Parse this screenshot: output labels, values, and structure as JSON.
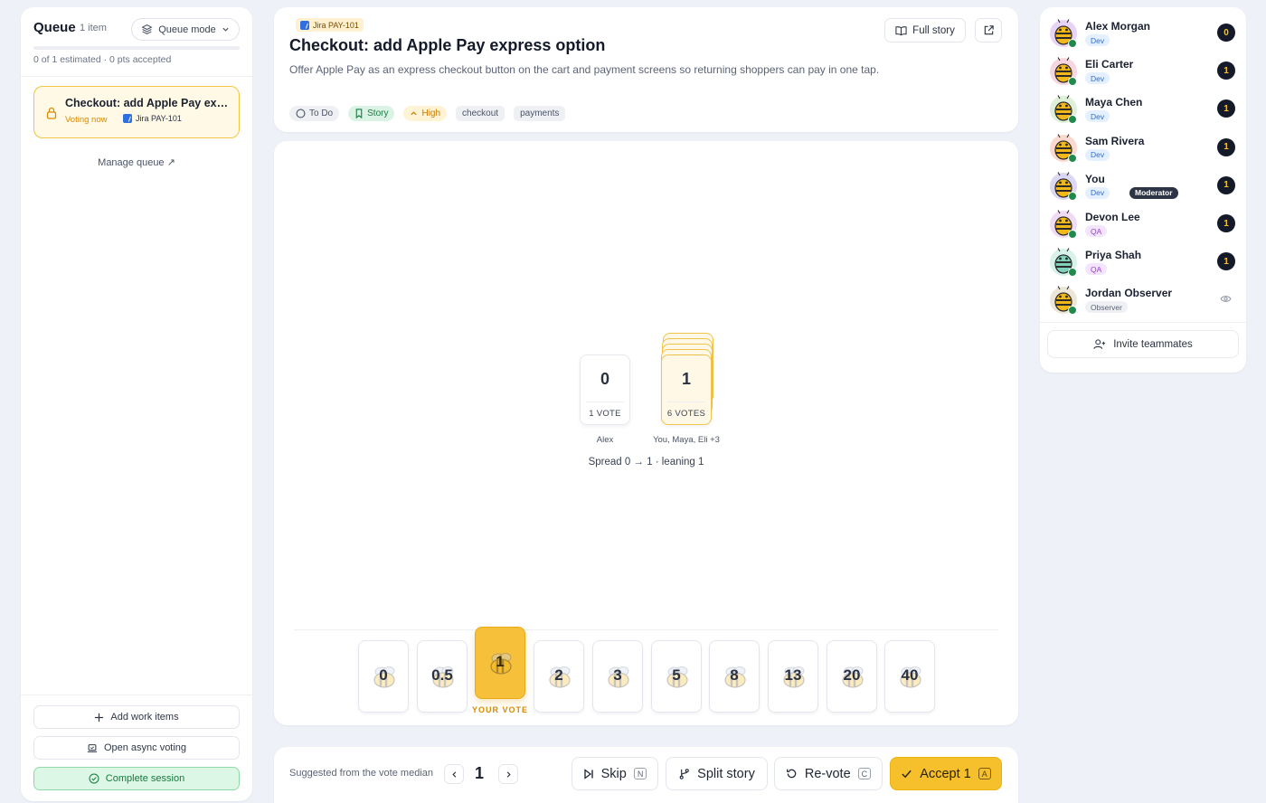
{
  "queue": {
    "title": "Queue",
    "count": "1 item",
    "mode_label": "Queue mode",
    "progress_fraction": 0,
    "stats": "0 of 1 estimated · 0 pts accepted",
    "item": {
      "title": "Checkout: add Apple Pay express option",
      "status": "Voting now",
      "jira": "Jira PAY-101"
    },
    "manage_label": "Manage queue ↗",
    "add_label": "Add work items",
    "async_label": "Open async voting",
    "complete_label": "Complete session"
  },
  "story": {
    "jira": "Jira PAY-101",
    "title": "Checkout: add Apple Pay express option",
    "description": "Offer Apple Pay as an express checkout button on the cart and payment screens so returning shoppers can pay in one tap.",
    "tags": {
      "status": "To Do",
      "type": "Story",
      "priority": "High",
      "label1": "checkout",
      "label2": "payments"
    },
    "full_story_label": "Full story"
  },
  "results": {
    "groups": [
      {
        "value": "0",
        "count": "1 VOTE",
        "voters": "Alex"
      },
      {
        "value": "1",
        "count": "6 VOTES",
        "voters": "You, Maya, Eli +3"
      }
    ],
    "spread": "Spread 0 → 1 · leaning 1"
  },
  "deck": {
    "cards": [
      "0",
      "0.5",
      "1",
      "2",
      "3",
      "5",
      "8",
      "13",
      "20",
      "40"
    ],
    "selected": "1",
    "your_vote_label": "YOUR VOTE"
  },
  "actions": {
    "suggest_label": "Suggested from the vote median",
    "suggested_value": "1",
    "skip_label": "Skip",
    "skip_key": "N",
    "split_label": "Split story",
    "revote_label": "Re-vote",
    "revote_key": "C",
    "accept_label": "Accept 1",
    "accept_key": "A"
  },
  "participants": [
    {
      "name": "Alex Morgan",
      "role": "Dev",
      "vote": "0"
    },
    {
      "name": "Eli Carter",
      "role": "Dev",
      "vote": "1"
    },
    {
      "name": "Maya Chen",
      "role": "Dev",
      "vote": "1"
    },
    {
      "name": "Sam Rivera",
      "role": "Dev",
      "vote": "1"
    },
    {
      "name": "You",
      "role": "Dev",
      "vote": "1",
      "badge": "Moderator"
    },
    {
      "name": "Devon Lee",
      "role": "QA",
      "vote": "1"
    },
    {
      "name": "Priya Shah",
      "role": "QA",
      "vote": "1"
    },
    {
      "name": "Jordan Observer",
      "role": "Observer",
      "vote": ""
    }
  ],
  "invite_label": "Invite teammates",
  "colors": {
    "accent": "#f6c02c",
    "online": "#1f8a4c",
    "dev_role": "#2a6fd6",
    "qa_role": "#9b3fd6"
  }
}
